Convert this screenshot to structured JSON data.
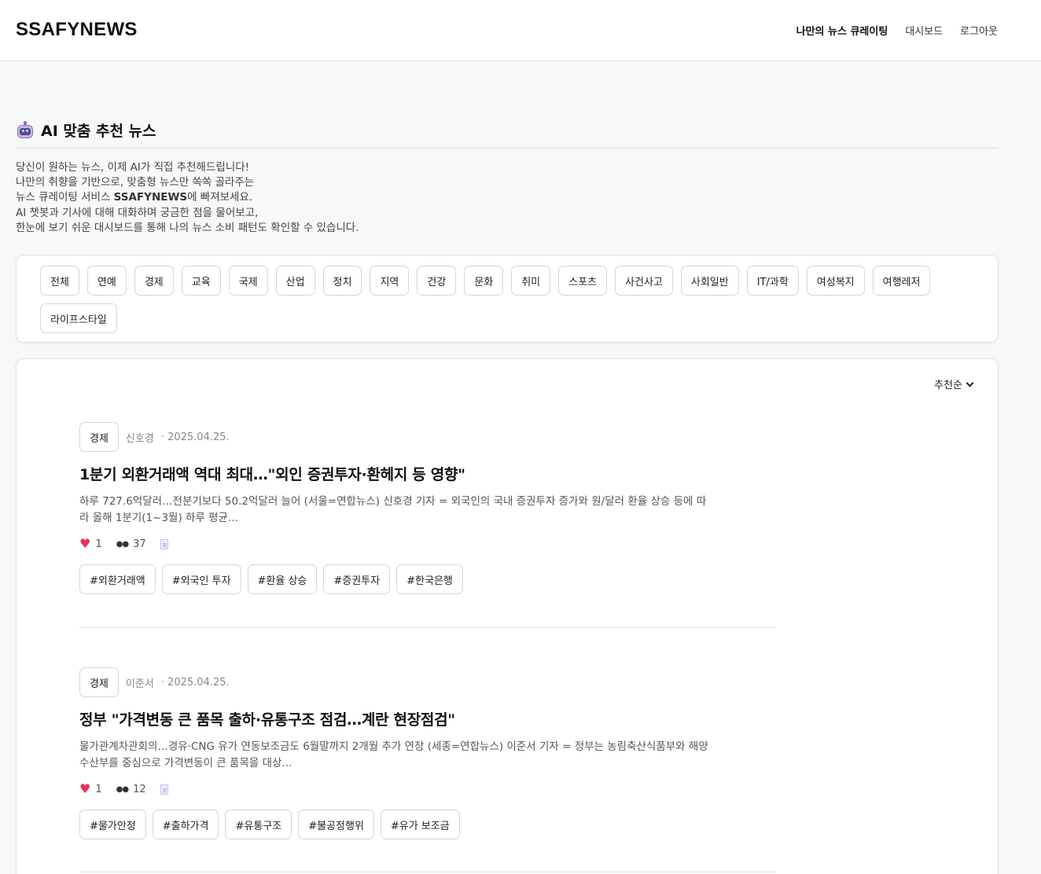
{
  "header": {
    "logo": "SSAFYNEWS",
    "nav": [
      "나만의 뉴스 큐레이팅",
      "대시보드",
      "로그아웃"
    ]
  },
  "section": {
    "title": "AI 맞춤 추천 뉴스",
    "intro": {
      "line1": "당신이 원하는 뉴스, 이제 AI가 직접 추천해드립니다!",
      "line2": "나만의 취향을 기반으로, 맞춤형 뉴스만 쏙쏙 골라주는",
      "line3_pre": "뉴스 큐레이팅 서비스 ",
      "line3_brand": "SSAFYNEWS",
      "line3_post": "에 빠져보세요.",
      "line4": "AI 챗봇과 기사에 대해 대화하며 궁금한 점을 물어보고,",
      "line5": "한눈에 보기 쉬운 대시보드를 통해 나의 뉴스 소비 패턴도 확인할 수 있습니다."
    }
  },
  "categories": [
    "전체",
    "연예",
    "경제",
    "교육",
    "국제",
    "산업",
    "정치",
    "지역",
    "건강",
    "문화",
    "취미",
    "스포츠",
    "사건사고",
    "사회일반",
    "IT/과학",
    "여성복지",
    "여행레저",
    "라이프스타일"
  ],
  "sort": {
    "label": "추천순"
  },
  "articles": [
    {
      "category": "경제",
      "author": "신호경",
      "date": "· 2025.04.25.",
      "title": "1분기 외환거래액 역대 최대…\"외인 증권투자·환헤지 등 영향\"",
      "summary": "하루 727.6억달러…전분기보다 50.2억달러 늘어 (서울=연합뉴스) 신호경 기자 = 외국인의 국내 증권투자 증가와 원/달러 환율 상승 등에 따라 올해 1분기(1~3월) 하루 평균...",
      "likes": "1",
      "views": "37",
      "hashtags": [
        "#외환거래액",
        "#외국인 투자",
        "#환율 상승",
        "#증권투자",
        "#한국은행"
      ]
    },
    {
      "category": "경제",
      "author": "이준서",
      "date": "· 2025.04.25.",
      "title": "정부 \"가격변동 큰 품목 출하·유통구조 점검…계란 현장점검\"",
      "summary": "물가관계차관회의…경유·CNG 유가 연동보조금도 6월말까지 2개월 추가 연장 (세종=연합뉴스) 이준서 기자 = 정부는 농림축산식품부와 해양수산부를 중심으로 가격변동이 큰 품목을 대상...",
      "likes": "1",
      "views": "12",
      "hashtags": [
        "#물가안정",
        "#출하가격",
        "#유통구조",
        "#불공정행위",
        "#유가 보조금"
      ]
    }
  ]
}
